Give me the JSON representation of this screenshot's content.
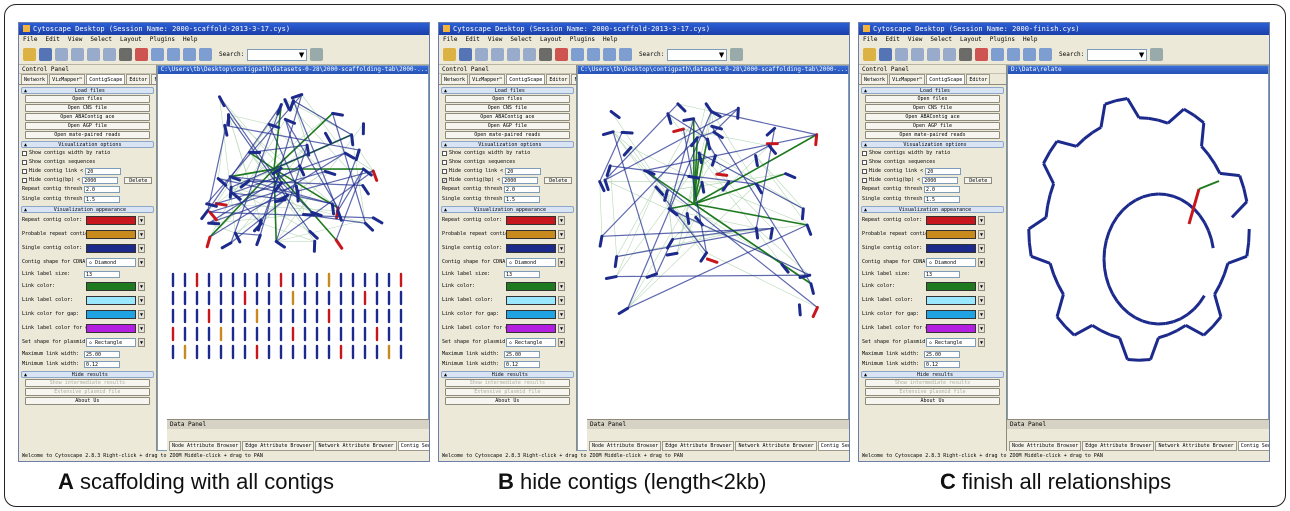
{
  "colors": {
    "repeat_contig": "#c8161d",
    "probable_repeat": "#c8891d",
    "single_contig": "#1c2a8c",
    "link": "#1f7a1f",
    "link_label": "#99e8ff",
    "link_gap": "#1fa3e3",
    "link_label_gap": "#b41ee0"
  },
  "panels": [
    {
      "id": "A",
      "title": "Cytoscape Desktop (Session Name: 2000-scaffold-2013-3-17.cys)",
      "tabs": [
        "Network",
        "VizMapper™",
        "ContigScape",
        "Editor",
        "Filters"
      ],
      "network_title": "C:\\Users\\tb\\Desktop\\contigpath\\datasets-0-28\\2000-scaffolding-tab\\2000-..."
    },
    {
      "id": "B",
      "title": "Cytoscape Desktop (Session Name: 2000-scaffold-2013-3-17.cys)",
      "tabs": [
        "Network",
        "VizMapper™",
        "ContigScape",
        "Editor",
        "Filters"
      ],
      "network_title": "C:\\Users\\tb\\Desktop\\contigpath\\datasets-0-28\\2000-scaffolding-tab\\2000-..."
    },
    {
      "id": "C",
      "title": "Cytoscape Desktop (Session Name: 2000-finish.cys)",
      "tabs": [
        "Network",
        "VizMapper™",
        "ContigScape",
        "Editor"
      ],
      "network_title": "D:\\Data\\relate"
    }
  ],
  "menu": [
    "File",
    "Edit",
    "View",
    "Select",
    "Layout",
    "Plugins",
    "Help"
  ],
  "search_label": "Search:",
  "control_panel_title": "Control Panel",
  "load": {
    "section": "Load files",
    "buttons": [
      "Open files",
      "Open CNS file",
      "Open ABAContig ace",
      "Open AGP file",
      "Open mate-paired reads"
    ]
  },
  "viz_options": {
    "section": "Visualization options",
    "show_width": "Show contigs width by ratio",
    "show_sequences": "Show contigs sequences",
    "hide_link": "Hide contig link <",
    "hide_link_value": "20",
    "hide_contig": "Hide contig(bp) <",
    "hide_contig_value": "2000",
    "delete": "Delete",
    "repeat_threshold": "Repeat contig threshold",
    "repeat_threshold_value": "2.0",
    "single_threshold": "Single contig threshold",
    "single_threshold_value": "1.5"
  },
  "appearance": {
    "section": "Visualization appearance",
    "repeat_color": "Repeat contig color:",
    "probable_color": "Probable repeat contig",
    "single_color": "Single contig color:",
    "shape_label": "Contig shape for CDNA",
    "shape_value": "Diamond",
    "link_label_size": "Link label size:",
    "link_label_size_value": "13",
    "link_color": "Link color:",
    "link_label_color": "Link label color:",
    "link_gap_color": "Link color for gap:",
    "link_label_gap_color": "Link label color for gap:",
    "plasmid_shape": "Set shape for plasmid:",
    "plasmid_value": "Rectangle",
    "max_width": "Maximum link width:",
    "max_width_value": "25.00",
    "min_width": "Minimum link width:",
    "min_width_value": "0.12"
  },
  "hide": {
    "section": "Hide results",
    "buttons": [
      "Show intermediate results",
      "Extensive plasmid file"
    ],
    "about": "About Us"
  },
  "data_panel": {
    "title": "Data Panel",
    "tabs": [
      "Node Attribute Browser",
      "Edge Attribute Browser",
      "Network Attribute Browser",
      "Contig Sequences"
    ]
  },
  "status": {
    "welcome": "Welcome to Cytoscape 2.8.3",
    "hint": "Right-click + drag to ZOOM",
    "hint2": "Middle-click + drag to PAN"
  },
  "captions": [
    {
      "letter": "A",
      "text": "scaffolding with all contigs"
    },
    {
      "letter": "B",
      "text": "hide contigs (length<2kb)"
    },
    {
      "letter": "C",
      "text": "finish all relationships"
    }
  ]
}
